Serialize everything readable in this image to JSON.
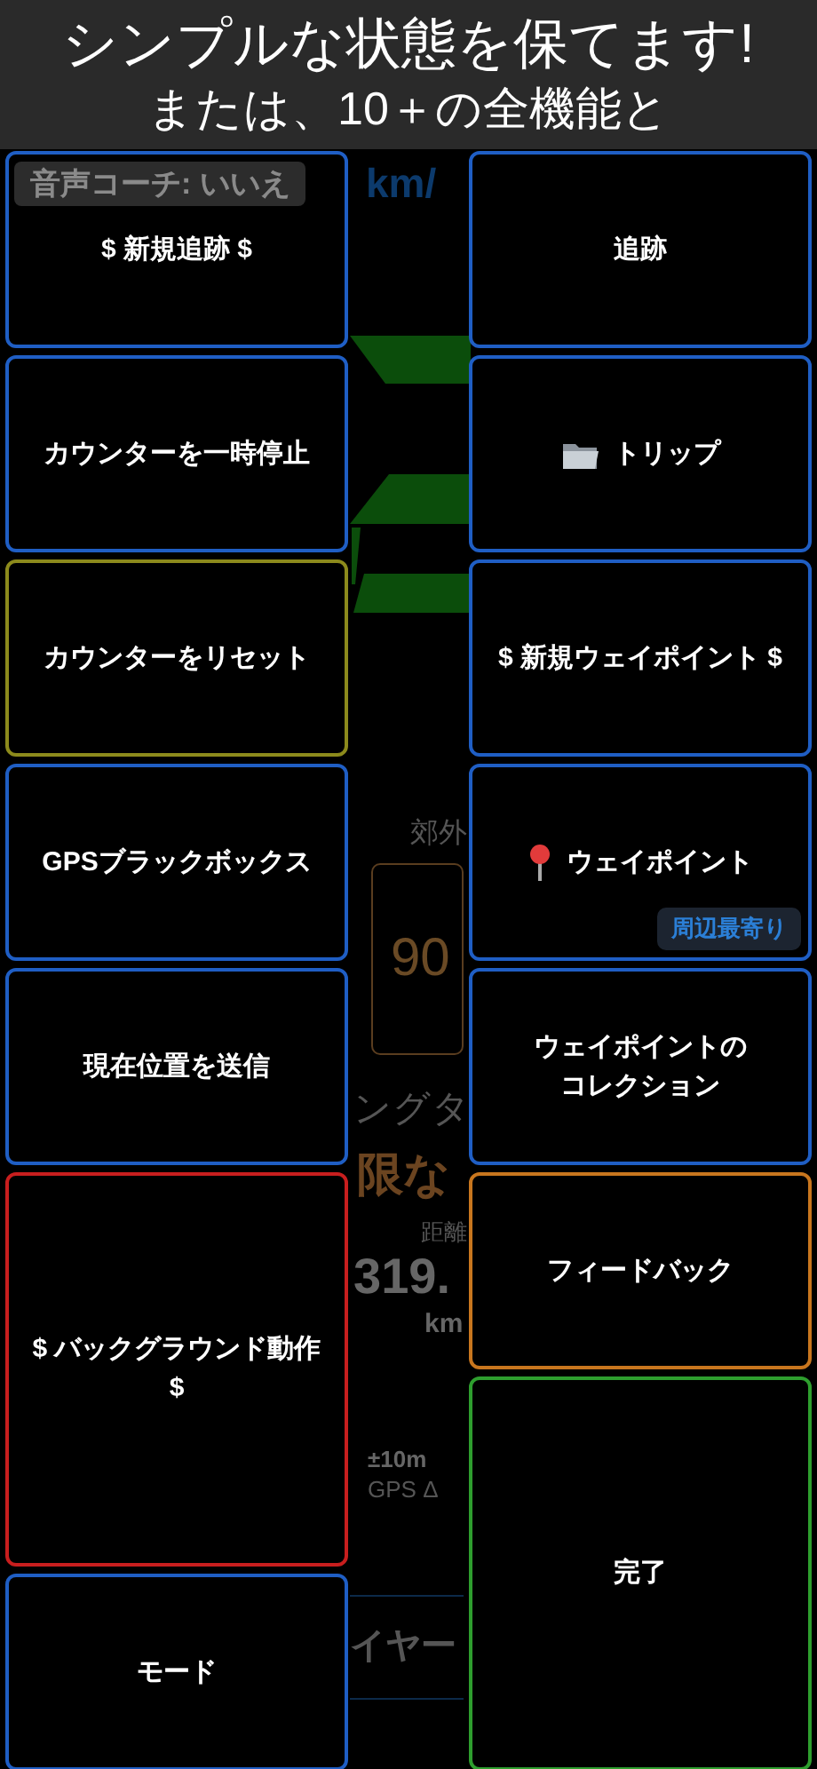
{
  "header": {
    "title": "シンプルな状態を保てます!",
    "subtitle": "または、10＋の全機能と"
  },
  "background": [
    {
      "kind": "speed-unit",
      "text": "km/"
    },
    {
      "kind": "graphic"
    },
    {
      "kind": "zone",
      "text": "郊外"
    },
    {
      "kind": "limit-box",
      "text": "90"
    },
    {
      "kind": "heading",
      "text": "ングタ"
    },
    {
      "kind": "limit",
      "text": "限な"
    },
    {
      "kind": "distance-label",
      "text": "距離"
    },
    {
      "kind": "distance",
      "text": "319."
    },
    {
      "kind": "distance-unit",
      "text": "km"
    },
    {
      "kind": "accuracy",
      "text": "±10m"
    },
    {
      "kind": "gps-label",
      "text": "GPS Δ"
    },
    {
      "kind": "layer",
      "text": "イヤー"
    }
  ],
  "voice_coach": "音声コーチ: いいえ",
  "left_buttons": [
    {
      "label": "$ 新規追跡 $",
      "kind": "normal",
      "color": "#1f5ec4"
    },
    {
      "label": "カウンターを一時停止",
      "kind": "normal",
      "color": "#1f5ec4"
    },
    {
      "label": "カウンターをリセット",
      "kind": "normal",
      "color": "#8c8a1c"
    },
    {
      "label": "GPSブラックボックス",
      "kind": "normal",
      "color": "#1f5ec4"
    },
    {
      "label": "現在位置を送信",
      "kind": "normal",
      "color": "#1f5ec4"
    },
    {
      "label": "$ バックグラウンド動作 $",
      "kind": "tall",
      "color": "#c81e1e"
    },
    {
      "label": "モード",
      "kind": "normal",
      "color": "#1f5ec4"
    }
  ],
  "right_buttons": [
    {
      "label": "追跡",
      "kind": "normal",
      "color": "#1f5ec4"
    },
    {
      "label": "トリップ",
      "kind": "trip",
      "color": "#1f5ec4"
    },
    {
      "label": "$ 新規ウェイポイント $",
      "kind": "normal",
      "color": "#1f5ec4"
    },
    {
      "label": "ウェイポイント",
      "kind": "waypoint",
      "color": "#1f5ec4",
      "badge": "周辺最寄り"
    },
    {
      "label": "ウェイポイントのコレクション",
      "kind": "narrow",
      "color": "#1f5ec4"
    },
    {
      "label": "フィードバック",
      "kind": "normal",
      "color": "#c8761e"
    },
    {
      "label": "完了",
      "kind": "tall",
      "color": "#2e9e2e"
    }
  ]
}
